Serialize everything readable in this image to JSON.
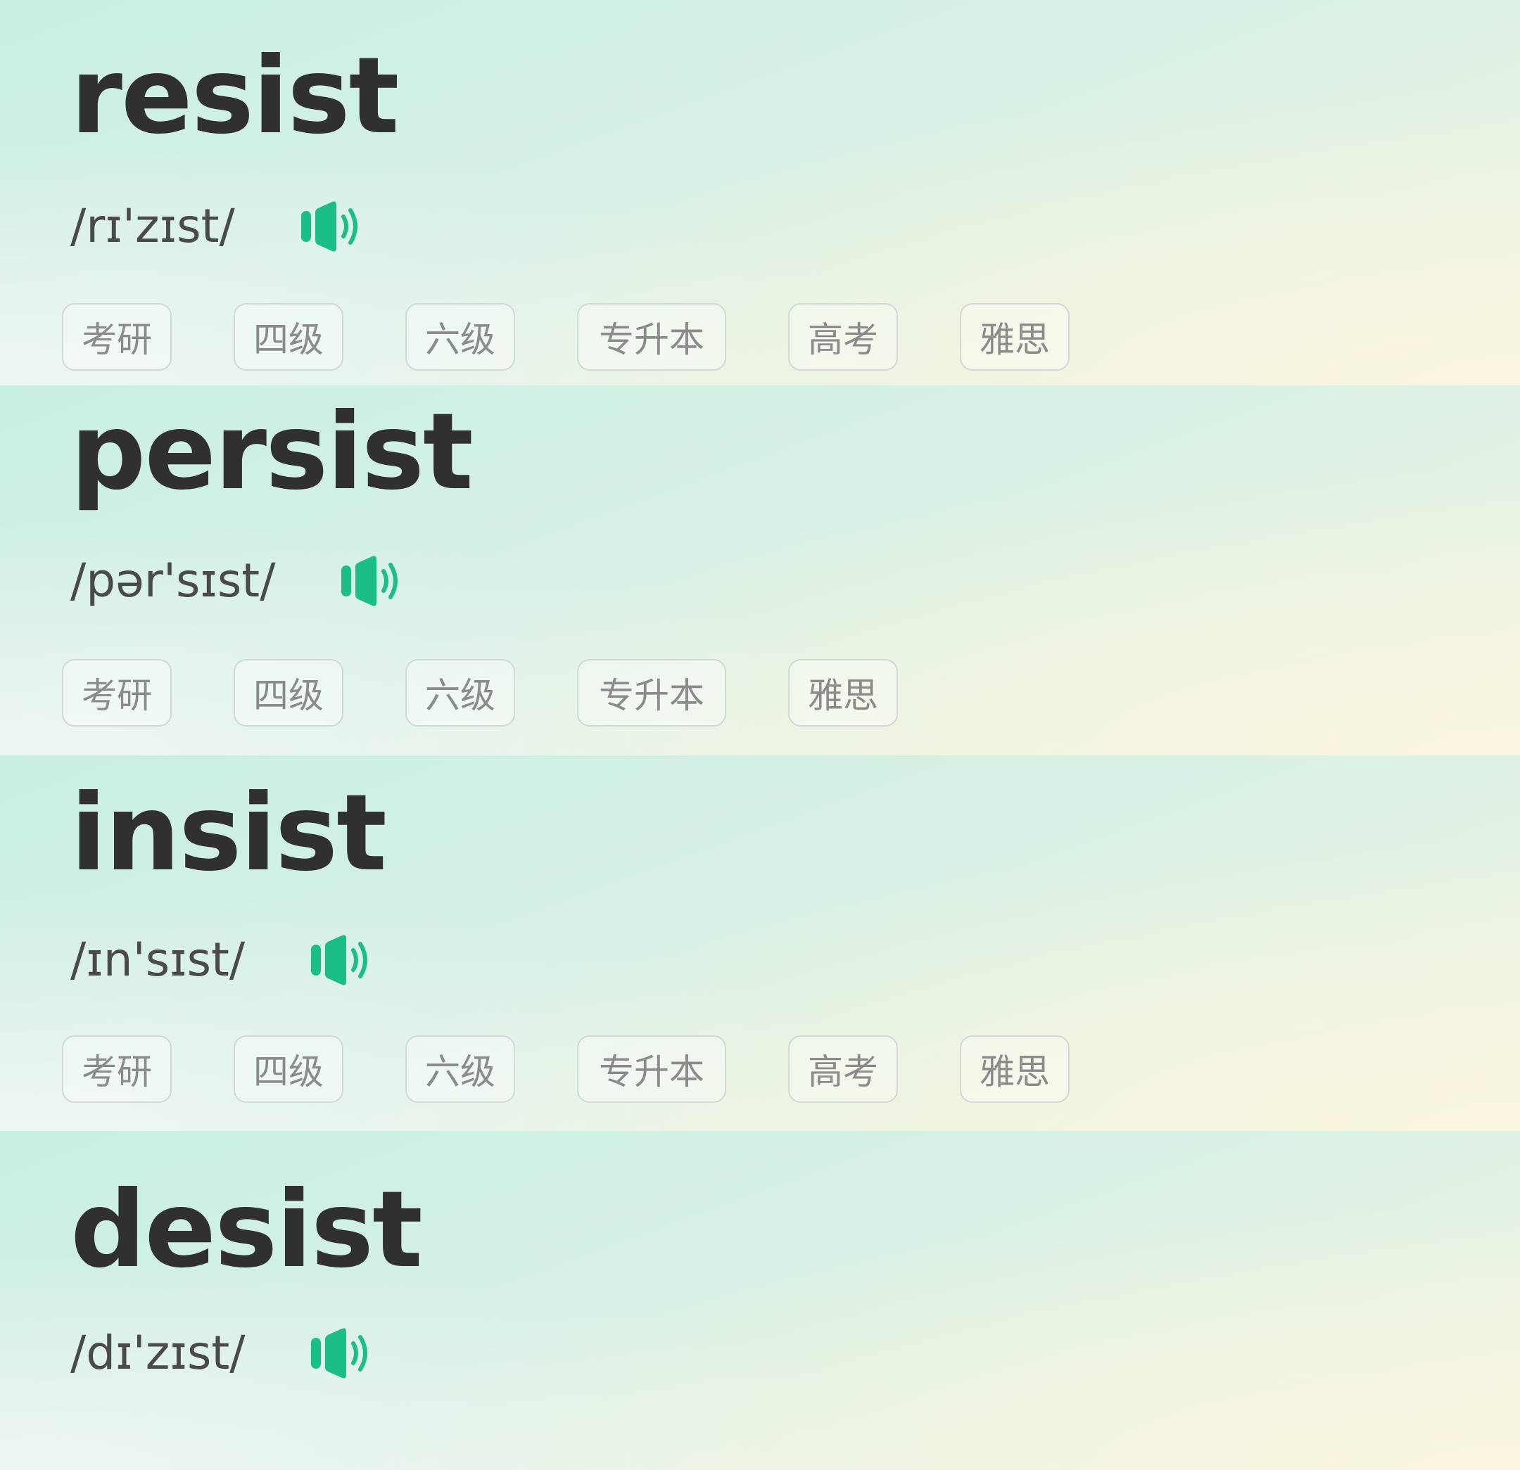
{
  "words": [
    {
      "word": "resist",
      "phonetic": "/rɪ'zɪst/",
      "tags": [
        "考研",
        "四级",
        "六级",
        "专升本",
        "高考",
        "雅思"
      ]
    },
    {
      "word": "persist",
      "phonetic": "/pər'sɪst/",
      "tags": [
        "考研",
        "四级",
        "六级",
        "专升本",
        "雅思"
      ]
    },
    {
      "word": "insist",
      "phonetic": "/ɪn'sɪst/",
      "tags": [
        "考研",
        "四级",
        "六级",
        "专升本",
        "高考",
        "雅思"
      ]
    },
    {
      "word": "desist",
      "phonetic": "/dɪ'zɪst/",
      "tags": []
    }
  ],
  "icons": {
    "speaker": "speaker-sound-icon"
  },
  "colors": {
    "accent": "#1bbf86",
    "word_text": "#303030",
    "phonetic_text": "#4a4a4a",
    "tag_text": "#8b8b8b",
    "tag_border": "#d2d8d4"
  }
}
